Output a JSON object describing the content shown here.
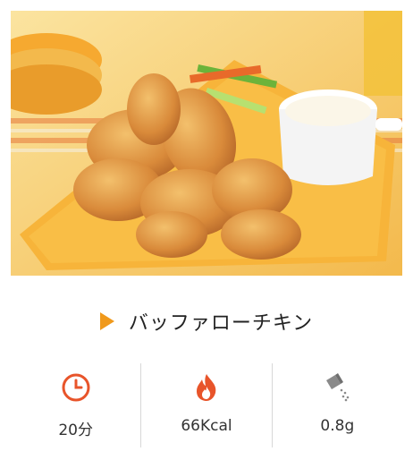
{
  "recipe": {
    "title": "バッファローチキン",
    "photo_icon": "buffalo-chicken-photo"
  },
  "stats": [
    {
      "icon": "clock-icon",
      "value": "20分"
    },
    {
      "icon": "flame-icon",
      "value": "66Kcal"
    },
    {
      "icon": "salt-shaker-icon",
      "value": "0.8g"
    }
  ],
  "colors": {
    "accent": "#f0991b",
    "icon_red": "#e8542a",
    "salt_gray": "#8a8a8a"
  }
}
